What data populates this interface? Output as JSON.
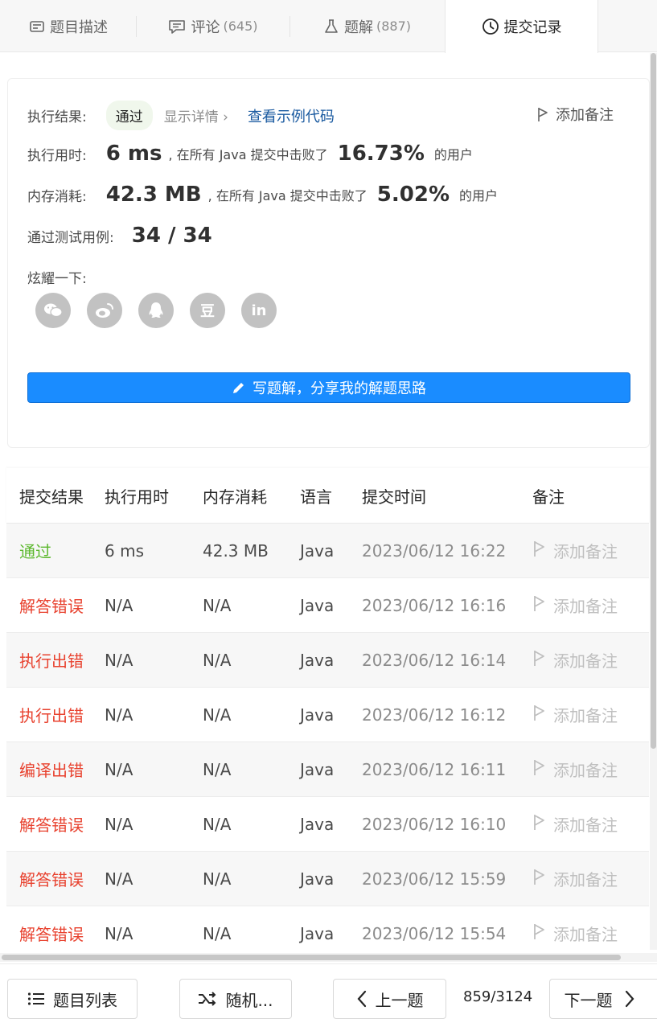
{
  "tabs": [
    {
      "label": "题目描述",
      "count": ""
    },
    {
      "label": "评论",
      "count": "(645)"
    },
    {
      "label": "题解",
      "count": "(887)"
    },
    {
      "label": "提交记录",
      "count": ""
    }
  ],
  "result": {
    "status_label": "执行结果:",
    "status_value": "通过",
    "details_link": "显示详情 ›",
    "example_link": "查看示例代码",
    "add_note": "添加备注",
    "runtime_label": "执行用时:",
    "runtime_value": "6 ms",
    "runtime_text": ", 在所有 Java 提交中击败了",
    "runtime_percent": "16.73%",
    "runtime_suffix": "的用户",
    "memory_label": "内存消耗:",
    "memory_value": "42.3 MB",
    "memory_text": ", 在所有 Java 提交中击败了",
    "memory_percent": "5.02%",
    "memory_suffix": "的用户",
    "tests_label": "通过测试用例:",
    "tests_value": "34 / 34",
    "share_label": "炫耀一下:",
    "share_douban": "豆",
    "share_linkedin": "in",
    "write_button": "写题解，分享我的解题思路"
  },
  "table": {
    "headers": [
      "提交结果",
      "执行用时",
      "内存消耗",
      "语言",
      "提交时间",
      "备注"
    ],
    "rows": [
      {
        "status": "通过",
        "runtime": "6 ms",
        "memory": "42.3 MB",
        "lang": "Java",
        "time": "2023/06/12 16:22",
        "note": "添加备注"
      },
      {
        "status": "解答错误",
        "runtime": "N/A",
        "memory": "N/A",
        "lang": "Java",
        "time": "2023/06/12 16:16",
        "note": "添加备注"
      },
      {
        "status": "执行出错",
        "runtime": "N/A",
        "memory": "N/A",
        "lang": "Java",
        "time": "2023/06/12 16:14",
        "note": "添加备注"
      },
      {
        "status": "执行出错",
        "runtime": "N/A",
        "memory": "N/A",
        "lang": "Java",
        "time": "2023/06/12 16:12",
        "note": "添加备注"
      },
      {
        "status": "编译出错",
        "runtime": "N/A",
        "memory": "N/A",
        "lang": "Java",
        "time": "2023/06/12 16:11",
        "note": "添加备注"
      },
      {
        "status": "解答错误",
        "runtime": "N/A",
        "memory": "N/A",
        "lang": "Java",
        "time": "2023/06/12 16:10",
        "note": "添加备注"
      },
      {
        "status": "解答错误",
        "runtime": "N/A",
        "memory": "N/A",
        "lang": "Java",
        "time": "2023/06/12 15:59",
        "note": "添加备注"
      },
      {
        "status": "解答错误",
        "runtime": "N/A",
        "memory": "N/A",
        "lang": "Java",
        "time": "2023/06/12 15:54",
        "note": "添加备注"
      }
    ]
  },
  "footer": {
    "list_button": "题目列表",
    "random_button": "随机...",
    "prev_button": "上一题",
    "pager": "859/3124",
    "next_button": "下一题"
  },
  "colors": {
    "accent": "#1a8cff",
    "success": "#5cb82e",
    "error": "#e8412e",
    "link": "#1a5aa0"
  }
}
